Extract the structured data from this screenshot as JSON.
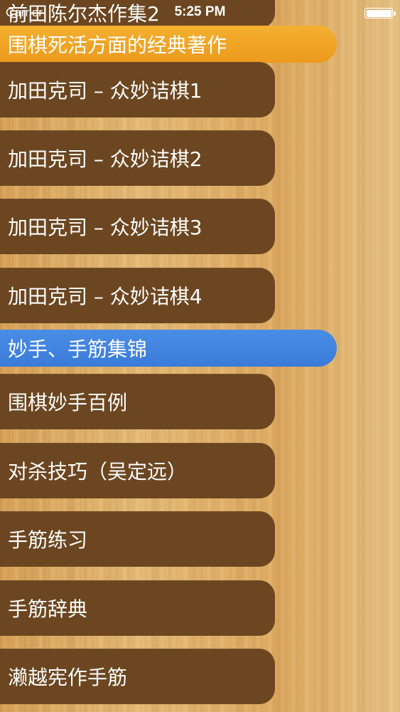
{
  "status_bar": {
    "carrier": "Carrier",
    "time": "5:25 PM",
    "battery_level": 1.0
  },
  "list": {
    "items": [
      {
        "label": "前田陈尔杰作集2",
        "kind": "row"
      },
      {
        "label": "围棋死活方面的经典著作",
        "kind": "section-header",
        "color": "#f0a024"
      },
      {
        "label": "加田克司 – 众妙诘棋1",
        "kind": "row"
      },
      {
        "label": "加田克司 – 众妙诘棋2",
        "kind": "row"
      },
      {
        "label": "加田克司 – 众妙诘棋3",
        "kind": "row"
      },
      {
        "label": "加田克司 – 众妙诘棋4",
        "kind": "row"
      },
      {
        "label": "妙手、手筋集锦",
        "kind": "section-header",
        "color": "#3a7bd9"
      },
      {
        "label": "围棋妙手百例",
        "kind": "row"
      },
      {
        "label": "对杀技巧（吴定远）",
        "kind": "row"
      },
      {
        "label": "手筋练习",
        "kind": "row"
      },
      {
        "label": "手筋辞典",
        "kind": "row"
      },
      {
        "label": "濑越宪作手筋",
        "kind": "row"
      }
    ]
  },
  "colors": {
    "row_background": "#6b4620",
    "header_orange": "#f0a024",
    "header_blue": "#3a7bd9",
    "wood_background": "#e3b26b"
  }
}
